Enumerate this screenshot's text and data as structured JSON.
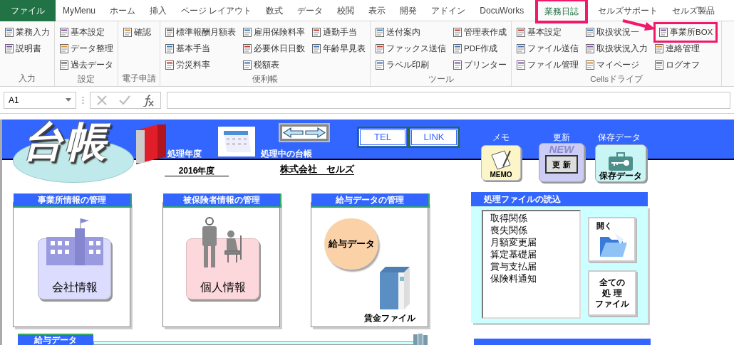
{
  "ribbon_tabs": [
    {
      "label": "ファイル",
      "kind": "file",
      "selected": false,
      "highlighted": false
    },
    {
      "label": "MyMenu",
      "kind": "tab",
      "selected": false,
      "highlighted": false
    },
    {
      "label": "ホーム",
      "kind": "tab",
      "selected": false,
      "highlighted": false
    },
    {
      "label": "挿入",
      "kind": "tab",
      "selected": false,
      "highlighted": false
    },
    {
      "label": "ページ レイアウト",
      "kind": "tab",
      "selected": false,
      "highlighted": false
    },
    {
      "label": "数式",
      "kind": "tab",
      "selected": false,
      "highlighted": false
    },
    {
      "label": "データ",
      "kind": "tab",
      "selected": false,
      "highlighted": false
    },
    {
      "label": "校閲",
      "kind": "tab",
      "selected": false,
      "highlighted": false
    },
    {
      "label": "表示",
      "kind": "tab",
      "selected": false,
      "highlighted": false
    },
    {
      "label": "開発",
      "kind": "tab",
      "selected": false,
      "highlighted": false
    },
    {
      "label": "アドイン",
      "kind": "tab",
      "selected": false,
      "highlighted": false
    },
    {
      "label": "DocuWorks",
      "kind": "tab",
      "selected": false,
      "highlighted": false
    },
    {
      "label": "業務日誌",
      "kind": "tab",
      "selected": true,
      "highlighted": true
    },
    {
      "label": "セルズサポート",
      "kind": "tab",
      "selected": false,
      "highlighted": false
    },
    {
      "label": "セルズ製品",
      "kind": "tab",
      "selected": false,
      "highlighted": false
    }
  ],
  "ribbon_groups": [
    {
      "label": "入力",
      "columns": [
        [
          {
            "label": "業務入力",
            "highlighted": false
          },
          {
            "label": "説明書",
            "highlighted": false
          }
        ]
      ]
    },
    {
      "label": "設定",
      "columns": [
        [
          {
            "label": "基本設定",
            "highlighted": false
          },
          {
            "label": "データ整理",
            "highlighted": false
          },
          {
            "label": "過去データ",
            "highlighted": false
          }
        ]
      ]
    },
    {
      "label": "電子申請",
      "columns": [
        [
          {
            "label": "確認",
            "highlighted": false
          }
        ]
      ]
    },
    {
      "label": "便利帳",
      "columns": [
        [
          {
            "label": "標準報酬月額表",
            "highlighted": false
          },
          {
            "label": "基本手当",
            "highlighted": false
          },
          {
            "label": "労災料率",
            "highlighted": false
          }
        ],
        [
          {
            "label": "雇用保険料率",
            "highlighted": false
          },
          {
            "label": "必要休日日数",
            "highlighted": false
          },
          {
            "label": "税額表",
            "highlighted": false
          }
        ],
        [
          {
            "label": "通勤手当",
            "highlighted": false
          },
          {
            "label": "年齢早見表",
            "highlighted": false
          }
        ]
      ]
    },
    {
      "label": "ツール",
      "columns": [
        [
          {
            "label": "送付案内",
            "highlighted": false
          },
          {
            "label": "ファックス送信",
            "highlighted": false
          },
          {
            "label": "ラベル印刷",
            "highlighted": false
          }
        ],
        [
          {
            "label": "管理表作成",
            "highlighted": false
          },
          {
            "label": "PDF作成",
            "highlighted": false
          },
          {
            "label": "プリンター",
            "highlighted": false
          }
        ]
      ]
    },
    {
      "label": "Cellsドライブ",
      "columns": [
        [
          {
            "label": "基本設定",
            "highlighted": false
          },
          {
            "label": "ファイル送信",
            "highlighted": false
          },
          {
            "label": "ファイル管理",
            "highlighted": false
          }
        ],
        [
          {
            "label": "取扱状況一",
            "highlighted": false
          },
          {
            "label": "取扱状況入力",
            "highlighted": false
          },
          {
            "label": "マイページ",
            "highlighted": false
          }
        ],
        [
          {
            "label": "事業所BOX",
            "highlighted": true
          },
          {
            "label": "連絡管理",
            "highlighted": false
          },
          {
            "label": "ログオフ",
            "highlighted": false
          }
        ]
      ]
    }
  ],
  "formula_bar": {
    "name_box": "A1"
  },
  "sheet": {
    "logo": "台帳",
    "year_label": "処理年度",
    "year": "2016年度",
    "ledger_label": "処理中の台帳",
    "company": "株式会社　セルズ",
    "link_buttons": [
      "TEL",
      "LINK"
    ],
    "tools": [
      {
        "kind": "memo",
        "caption": "メモ",
        "badge": "MEMO"
      },
      {
        "kind": "update",
        "caption": "更新",
        "badge": "更 新",
        "banner": "NEW"
      },
      {
        "kind": "save",
        "caption": "保存データ",
        "badge": "保存データ"
      }
    ],
    "cards": [
      {
        "kind": "company",
        "title": "事業所情報の管理",
        "button": "会社情報"
      },
      {
        "kind": "person",
        "title": "被保険者情報の管理",
        "button": "個人情報"
      },
      {
        "kind": "salary",
        "title": "給与データの管理",
        "button": "給与データ",
        "file_label": "賃金ファイル"
      }
    ],
    "file_panel": {
      "title": "処理ファイルの読込",
      "files": [
        "取得関係",
        "喪失関係",
        "月額変更届",
        "算定基礎届",
        "賞与支払届",
        "保険料通知"
      ],
      "open_button": "開く",
      "all_button": [
        "全ての",
        "処 理",
        "ファイル"
      ]
    },
    "bottom_tab": "給与データ"
  }
}
